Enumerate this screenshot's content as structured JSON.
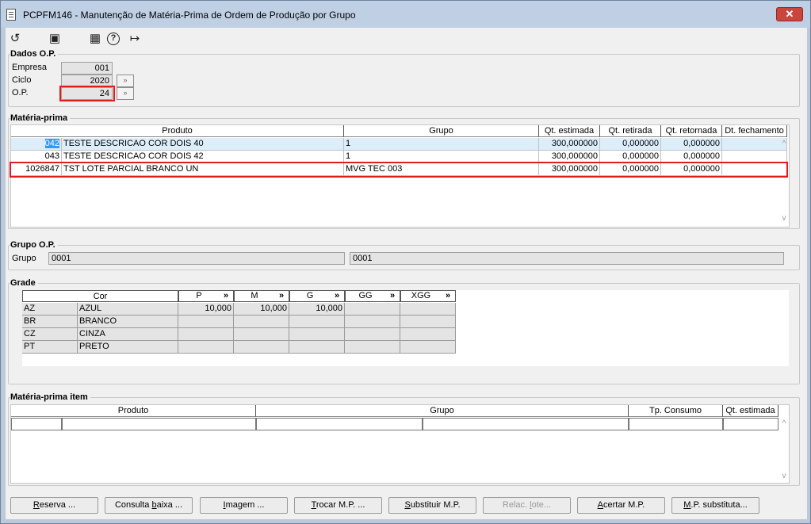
{
  "window": {
    "title": "PCPFM146 - Manutenção de Matéria-Prima de Ordem de Produção por Grupo",
    "close_glyph": "✕"
  },
  "toolbar": {
    "items": [
      {
        "icon": "undo-icon",
        "glyph": "↺"
      },
      {
        "icon": "save-icon",
        "glyph": "▣"
      },
      {
        "icon": "calendar-icon",
        "glyph": "▦"
      },
      {
        "icon": "help-icon",
        "glyph": "?"
      },
      {
        "icon": "exit-icon",
        "glyph": "↦"
      }
    ]
  },
  "dados_op": {
    "title": "Dados O.P.",
    "empresa_label": "Empresa",
    "empresa_value": "001",
    "ciclo_label": "Ciclo",
    "ciclo_value": "2020",
    "op_label": "O.P.",
    "op_value": "24",
    "lookup_glyph": "»"
  },
  "materia_prima": {
    "title": "Matéria-prima",
    "columns": [
      "Produto",
      "Grupo",
      "Qt. estimada",
      "Qt. retirada",
      "Qt. retornada",
      "Dt. fechamento"
    ],
    "rows": [
      {
        "code": "042",
        "produto": "TESTE DESCRICAO COR DOIS 40",
        "grupo": "1",
        "qt_estimada": "300,000000",
        "qt_retirada": "0,000000",
        "qt_retornada": "0,000000",
        "dt_fechamento": ""
      },
      {
        "code": "043",
        "produto": "TESTE DESCRICAO COR DOIS 42",
        "grupo": "1",
        "qt_estimada": "300,000000",
        "qt_retirada": "0,000000",
        "qt_retornada": "0,000000",
        "dt_fechamento": ""
      },
      {
        "code": "1026847",
        "produto": "TST LOTE PARCIAL BRANCO UN",
        "grupo": "MVG TEC 003",
        "qt_estimada": "300,000000",
        "qt_retirada": "0,000000",
        "qt_retornada": "0,000000",
        "dt_fechamento": ""
      }
    ],
    "scroll_up": "^",
    "scroll_down": "v"
  },
  "grupo_op": {
    "title": "Grupo O.P.",
    "label": "Grupo",
    "value1": "0001",
    "value2": "0001"
  },
  "grade": {
    "title": "Grade",
    "cor_header": "Cor",
    "sizes": [
      "P",
      "M",
      "G",
      "GG",
      "XGG"
    ],
    "size_btn": "»",
    "rows": [
      {
        "code": "AZ",
        "name": "AZUL",
        "values": [
          "10,000",
          "10,000",
          "10,000",
          "",
          ""
        ]
      },
      {
        "code": "BR",
        "name": "BRANCO",
        "values": [
          "",
          "",
          "",
          "",
          ""
        ]
      },
      {
        "code": "CZ",
        "name": "CINZA",
        "values": [
          "",
          "",
          "",
          "",
          ""
        ]
      },
      {
        "code": "PT",
        "name": "PRETO",
        "values": [
          "",
          "",
          "",
          "",
          ""
        ]
      }
    ]
  },
  "materia_prima_item": {
    "title": "Matéria-prima item",
    "columns": [
      "Produto",
      "Grupo",
      "Tp. Consumo",
      "Qt. estimada"
    ],
    "scroll_up": "^",
    "scroll_down": "v"
  },
  "buttons": [
    {
      "name": "reserva-button",
      "pre": "",
      "mnemonic": "R",
      "post": "eserva ...",
      "disabled": false
    },
    {
      "name": "consulta-baixa-button",
      "pre": "Consulta ",
      "mnemonic": "b",
      "post": "aixa ...",
      "disabled": false
    },
    {
      "name": "imagem-button",
      "pre": "",
      "mnemonic": "I",
      "post": "magem ...",
      "disabled": false
    },
    {
      "name": "trocar-mp-button",
      "pre": "",
      "mnemonic": "T",
      "post": "rocar M.P. ...",
      "disabled": false
    },
    {
      "name": "substituir-mp-button",
      "pre": "",
      "mnemonic": "S",
      "post": "ubstituir M.P.",
      "disabled": false
    },
    {
      "name": "relac-lote-button",
      "pre": "Relac. ",
      "mnemonic": "l",
      "post": "ote...",
      "disabled": true
    },
    {
      "name": "acertar-mp-button",
      "pre": "",
      "mnemonic": "A",
      "post": "certar M.P.",
      "disabled": false
    },
    {
      "name": "mp-substituta-button",
      "pre": "",
      "mnemonic": "M",
      "post": ".P. substituta...",
      "disabled": false
    }
  ]
}
